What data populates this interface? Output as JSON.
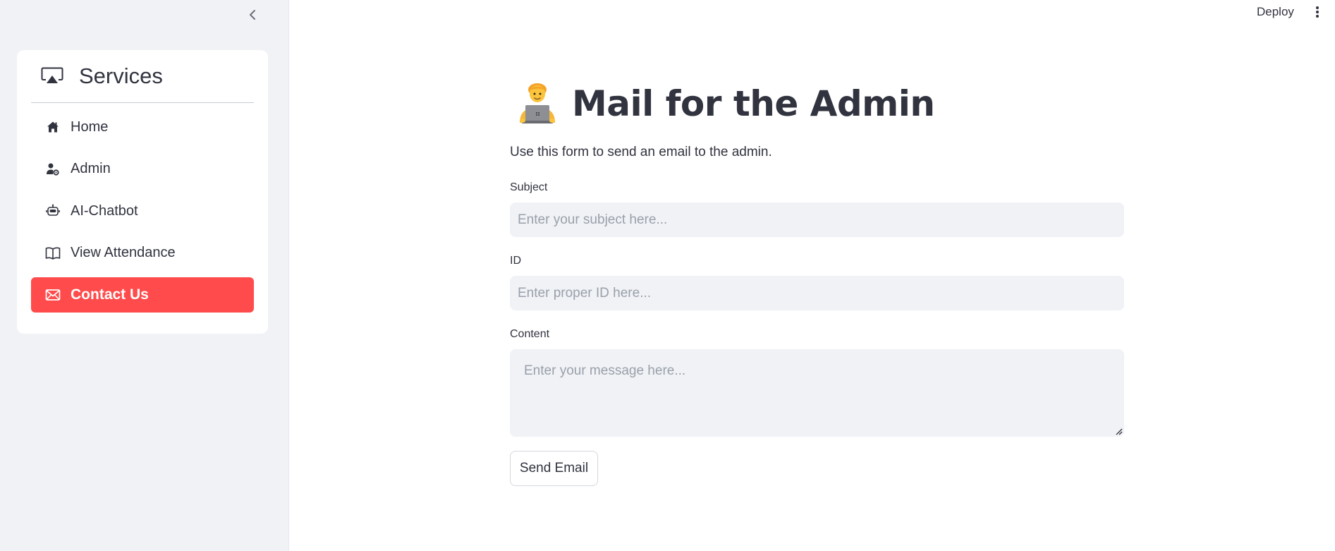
{
  "sidebar": {
    "collapse_icon": "chevron-left-icon",
    "menu": {
      "title": "Services",
      "title_icon": "airplay-icon",
      "items": [
        {
          "label": "Home",
          "icon": "house-icon"
        },
        {
          "label": "Admin",
          "icon": "person-gear-icon"
        },
        {
          "label": "AI-Chatbot",
          "icon": "robot-icon"
        },
        {
          "label": "View Attendance",
          "icon": "book-icon"
        },
        {
          "label": "Contact Us",
          "icon": "envelope-icon",
          "active": true
        }
      ]
    }
  },
  "topbar": {
    "deploy_label": "Deploy",
    "menu_icon": "kebab-menu-icon"
  },
  "main": {
    "title_emoji": "technologist-emoji",
    "title": "Mail for the Admin",
    "subtitle": "Use this form to send an email to the admin.",
    "fields": {
      "subject": {
        "label": "Subject",
        "placeholder": "Enter your subject here..."
      },
      "id": {
        "label": "ID",
        "placeholder": "Enter proper ID here..."
      },
      "content": {
        "label": "Content",
        "placeholder": "Enter your message here..."
      }
    },
    "send_button": "Send Email"
  },
  "colors": {
    "accent": "#ff4b4b",
    "sidebar_bg": "#f0f2f6",
    "input_bg": "#f0f2f6",
    "text": "#31333f"
  }
}
